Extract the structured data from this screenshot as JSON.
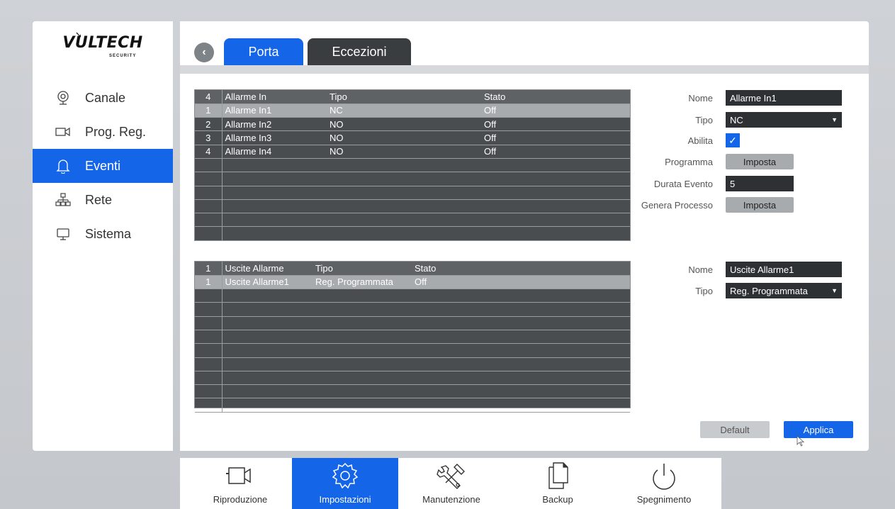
{
  "brand": {
    "name": "VULTECH",
    "sub": "SECURITY"
  },
  "sidebar": {
    "items": [
      {
        "label": "Canale",
        "icon": "camera-icon"
      },
      {
        "label": "Prog. Reg.",
        "icon": "video-icon"
      },
      {
        "label": "Eventi",
        "icon": "bell-icon",
        "active": true
      },
      {
        "label": "Rete",
        "icon": "network-icon"
      },
      {
        "label": "Sistema",
        "icon": "monitor-icon"
      }
    ]
  },
  "tabs": [
    {
      "label": "Porta",
      "active": true
    },
    {
      "label": "Eccezioni",
      "active": false
    }
  ],
  "alarm_in_table": {
    "headers": [
      "4",
      "Allarme In",
      "Tipo",
      "Stato"
    ],
    "rows": [
      [
        "1",
        "Allarme In1",
        "NC",
        "Off"
      ],
      [
        "2",
        "Allarme In2",
        "NO",
        "Off"
      ],
      [
        "3",
        "Allarme In3",
        "NO",
        "Off"
      ],
      [
        "4",
        "Allarme In4",
        "NO",
        "Off"
      ]
    ],
    "selected_row": 0
  },
  "alarm_out_table": {
    "headers": [
      "1",
      "Uscite Allarme",
      "Tipo",
      "Stato"
    ],
    "rows": [
      [
        "1",
        "Uscite Allarme1",
        "Reg. Programmata",
        "Off"
      ]
    ],
    "selected_row": 0
  },
  "form_in": {
    "nome_label": "Nome",
    "nome_value": "Allarme In1",
    "tipo_label": "Tipo",
    "tipo_value": "NC",
    "abilita_label": "Abilita",
    "abilita_checked": true,
    "programma_label": "Programma",
    "programma_btn": "Imposta",
    "durata_label": "Durata Evento",
    "durata_value": "5",
    "genera_label": "Genera Processo",
    "genera_btn": "Imposta"
  },
  "form_out": {
    "nome_label": "Nome",
    "nome_value": "Uscite Allarme1",
    "tipo_label": "Tipo",
    "tipo_value": "Reg. Programmata"
  },
  "actions": {
    "default_label": "Default",
    "apply_label": "Applica"
  },
  "bottombar": {
    "items": [
      {
        "label": "Riproduzione",
        "icon": "playback-camera-icon"
      },
      {
        "label": "Impostazioni",
        "icon": "settings-gear-icon",
        "active": true
      },
      {
        "label": "Manutenzione",
        "icon": "tools-icon"
      },
      {
        "label": "Backup",
        "icon": "backup-files-icon"
      },
      {
        "label": "Spegnimento",
        "icon": "power-icon"
      }
    ]
  },
  "colors": {
    "accent": "#1565e8",
    "table_bg": "#4a4d50",
    "panel": "#ffffff"
  }
}
